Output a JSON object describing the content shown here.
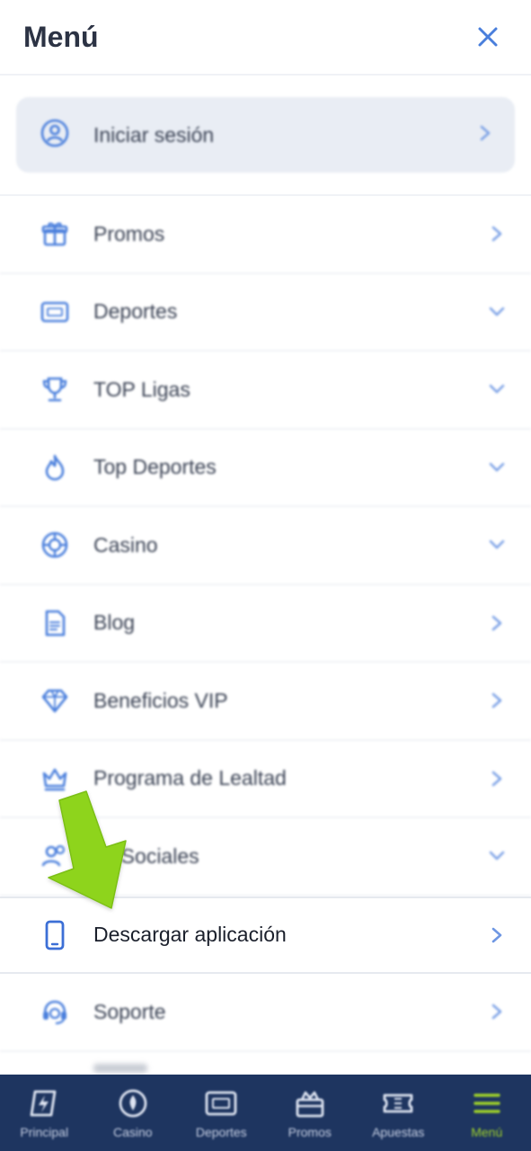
{
  "header": {
    "title": "Menú",
    "close_icon": "close-icon"
  },
  "login": {
    "label": "Iniciar sesión",
    "icon": "user-circle-icon"
  },
  "menu": {
    "items": [
      {
        "label": "Promos",
        "icon": "gift-icon",
        "chevron": "right"
      },
      {
        "label": "Deportes",
        "icon": "scoreboard-icon",
        "chevron": "down"
      },
      {
        "label": "TOP Ligas",
        "icon": "trophy-icon",
        "chevron": "down"
      },
      {
        "label": "Top Deportes",
        "icon": "flame-icon",
        "chevron": "down"
      },
      {
        "label": "Casino",
        "icon": "roulette-icon",
        "chevron": "down"
      },
      {
        "label": "Blog",
        "icon": "document-icon",
        "chevron": "right"
      },
      {
        "label": "Beneficios VIP",
        "icon": "diamond-icon",
        "chevron": "right"
      },
      {
        "label": "Programa de Lealtad",
        "icon": "crown-icon",
        "chevron": "right"
      },
      {
        "label": "es Sociales",
        "icon": "users-icon",
        "chevron": "down"
      },
      {
        "label": "Descargar aplicación",
        "icon": "smartphone-icon",
        "chevron": "right"
      },
      {
        "label": "Soporte",
        "icon": "headset-icon",
        "chevron": "right"
      }
    ]
  },
  "tabbar": {
    "tabs": [
      {
        "label": "Principal",
        "icon": "lightning-card-icon"
      },
      {
        "label": "Casino",
        "icon": "chip-icon"
      },
      {
        "label": "Deportes",
        "icon": "scoreboard-icon"
      },
      {
        "label": "Promos",
        "icon": "gift-box-icon"
      },
      {
        "label": "Apuestas",
        "icon": "ticket-icon"
      },
      {
        "label": "Menú",
        "icon": "hamburger-icon",
        "active": true
      }
    ]
  },
  "colors": {
    "accent_blue": "#4a7fdc",
    "tabbar_bg": "#1e3560",
    "active_green": "#9fd12a",
    "arrow_green": "#8ed41f"
  }
}
